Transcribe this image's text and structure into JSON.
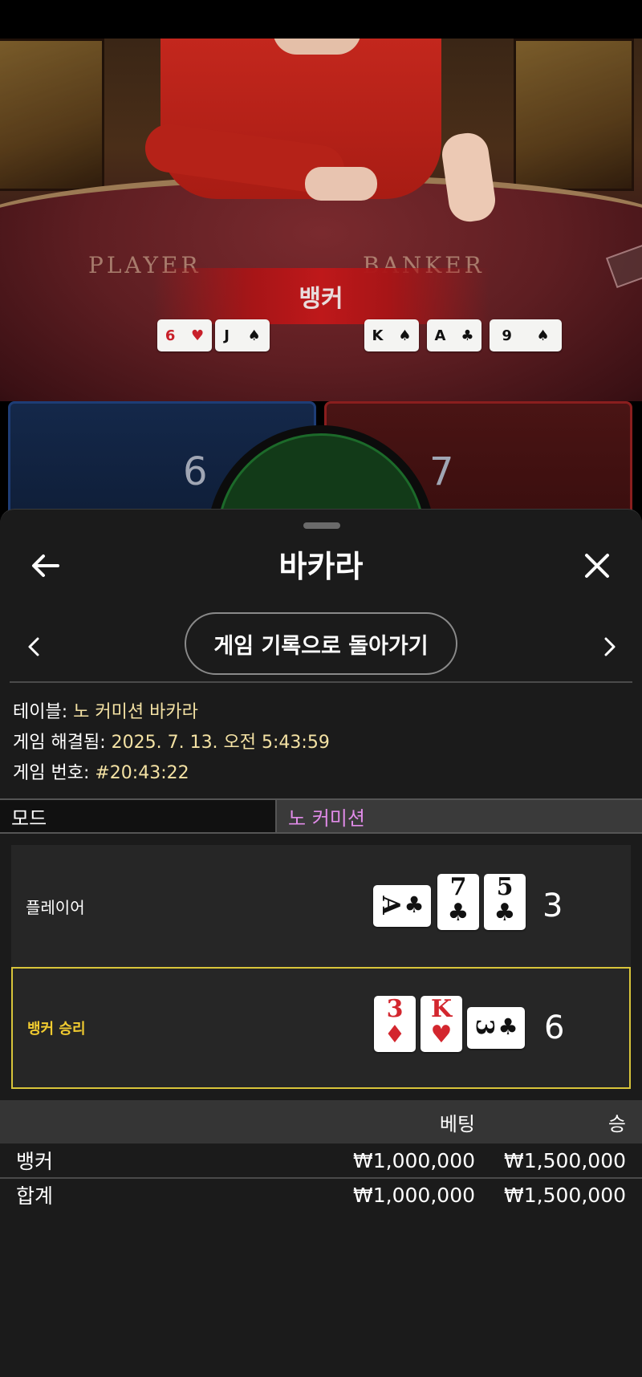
{
  "video": {
    "felt_player": "PLAYER",
    "felt_banker": "BANKER",
    "result_banner": "뱅커",
    "player_cards": [
      {
        "rank": "6",
        "suit": "♥",
        "red": true
      },
      {
        "rank": "J",
        "suit": "♠",
        "red": false
      }
    ],
    "banker_cards": [
      {
        "rank": "K",
        "suit": "♠",
        "red": false
      },
      {
        "rank": "A",
        "suit": "♣",
        "red": false
      },
      {
        "rank": "9",
        "suit": "♠",
        "red": false
      }
    ],
    "player_score": "6",
    "banker_score": "7"
  },
  "sheet": {
    "back_icon": "arrow-left-icon",
    "close_icon": "close-icon",
    "title": "바카라",
    "prev_icon": "chevron-left-icon",
    "next_icon": "chevron-right-icon",
    "back_to_history": "게임 기록으로 돌아가기",
    "info": {
      "table_label": "테이블:",
      "table_value": "노 커미션 바카라",
      "resolved_label": "게임 해결됨:",
      "resolved_value": "2025. 7. 13. 오전 5:43:59",
      "number_label": "게임 번호:",
      "number_value": "#20:43:22"
    },
    "mode": {
      "label": "모드",
      "value": "노 커미션"
    },
    "hands": {
      "player": {
        "label": "플레이어",
        "total": "3",
        "cards": [
          {
            "rank": "A",
            "suit": "♣",
            "red": false,
            "orientation": "horizontal"
          },
          {
            "rank": "7",
            "suit": "♣",
            "red": false,
            "orientation": "vertical"
          },
          {
            "rank": "5",
            "suit": "♣",
            "red": false,
            "orientation": "vertical"
          }
        ]
      },
      "banker": {
        "label": "뱅커 승리",
        "total": "6",
        "winner": true,
        "cards": [
          {
            "rank": "3",
            "suit": "♦",
            "red": true,
            "orientation": "vertical"
          },
          {
            "rank": "K",
            "suit": "♥",
            "red": true,
            "orientation": "vertical"
          },
          {
            "rank": "3",
            "suit": "♣",
            "red": false,
            "orientation": "horizontal"
          }
        ]
      }
    },
    "bets_table": {
      "headers": [
        "",
        "베팅",
        "승"
      ],
      "rows": [
        {
          "name": "뱅커",
          "bet": "₩1,000,000",
          "win": "₩1,500,000"
        },
        {
          "name": "합계",
          "bet": "₩1,000,000",
          "win": "₩1,500,000"
        }
      ]
    }
  },
  "colors": {
    "winner_gold": "#f2cc30",
    "info_value": "#f4e2a4",
    "mode_value": "#e08be8",
    "player_blue": "#14284a",
    "banker_red": "#4a1414"
  }
}
